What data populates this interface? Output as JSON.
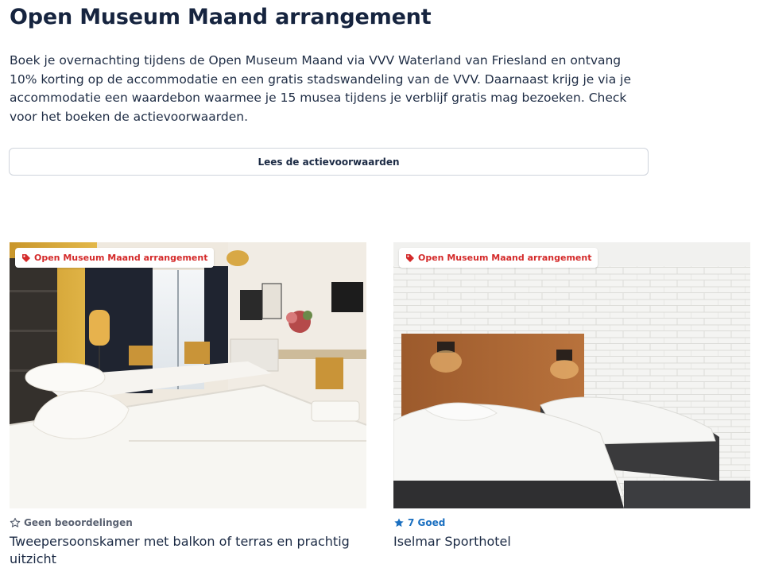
{
  "page": {
    "title": "Open Museum Maand arrangement",
    "intro": "Boek je overnachting tijdens de Open Museum Maand via VVV Waterland van Friesland en ontvang 10% korting op de accommodatie en een gratis stadswandeling van de VVV. Daarnaast krijg je via je accommodatie een waardebon waarmee je 15 musea tijdens je verblijf gratis mag bezoeken. Check voor het boeken de actievoorwaarden.",
    "terms_button": "Lees de actievoorwaarden"
  },
  "colors": {
    "badge_text": "#d42a2a",
    "rating_good": "#1a6fc0",
    "heading": "#16243f"
  },
  "cards": [
    {
      "badge": "Open Museum Maand arrangement",
      "badge_icon": "tag-icon",
      "rating_icon": "star-outline-icon",
      "rating": "Geen beoordelingen",
      "title": "Tweepersoonskamer met balkon of terras en prachtig uitzicht"
    },
    {
      "badge": "Open Museum Maand arrangement",
      "badge_icon": "tag-icon",
      "rating_icon": "star-filled-icon",
      "rating": "7 Goed",
      "title": "Iselmar Sporthotel"
    }
  ]
}
